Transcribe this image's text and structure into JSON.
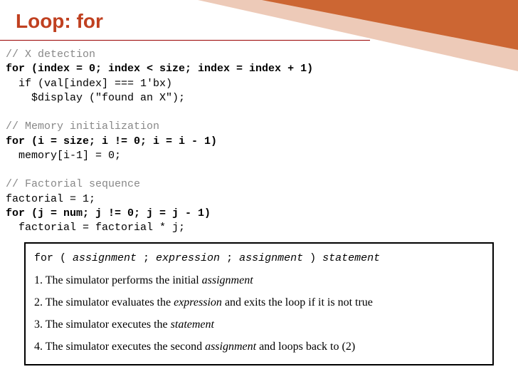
{
  "title": "Loop: for",
  "code": {
    "c1": "// X detection",
    "l1a": "for (index = 0; index < size; index = index + 1)",
    "l1b": "  if (val[index] === 1'bx)",
    "l1c": "    $display (\"found an X\");",
    "c2": "// Memory initialization",
    "l2a": "for (i = size; i != 0; i = i - 1)",
    "l2b": "  memory[i-1] = 0;",
    "c3": "// Factorial sequence",
    "l3a": "factorial = 1;",
    "l3b": "for (j = num; j != 0; j = j - 1)",
    "l3c": "  factorial = factorial * j;"
  },
  "syntax": {
    "t_for": "for ( ",
    "t_assignment1": "assignment",
    "t_sep1": " ; ",
    "t_expression": "expression",
    "t_sep2": " ; ",
    "t_assignment2": "assignment",
    "t_close": " ) ",
    "t_statement": "statement",
    "steps": {
      "s1a": "1.   The simulator performs the initial ",
      "s1b": "assignment",
      "s2a": "2.   The simulator evaluates the ",
      "s2b": "expression",
      "s2c": " and exits the loop if it is not true",
      "s3a": "3.   The simulator executes the ",
      "s3b": "statement",
      "s4a": "4.   The simulator executes the second ",
      "s4b": "assignment",
      "s4c": " and loops back to (2)"
    }
  }
}
